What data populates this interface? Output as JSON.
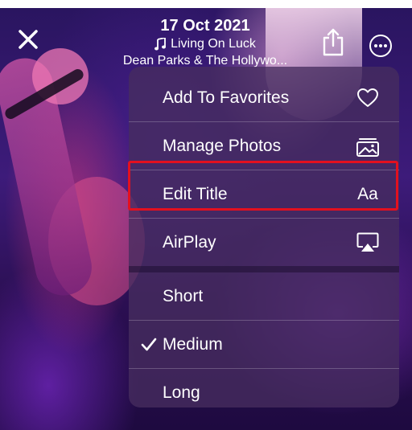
{
  "header": {
    "close_icon": "close-icon",
    "date": "17 Oct 2021",
    "music_icon": "music-note-icon",
    "song": "Living On Luck",
    "artist": "Dean Parks & The Hollywo...",
    "share_icon": "share-icon",
    "more_icon": "ellipsis-circle-icon"
  },
  "menu": {
    "items": [
      {
        "label": "Add To Favorites",
        "icon": "heart-icon"
      },
      {
        "label": "Manage Photos",
        "icon": "photos-icon"
      },
      {
        "label": "Edit Title",
        "icon": "text-format-icon",
        "icon_text": "Aa",
        "highlighted": true
      },
      {
        "label": "AirPlay",
        "icon": "airplay-icon"
      }
    ],
    "durations": [
      {
        "label": "Short",
        "selected": false
      },
      {
        "label": "Medium",
        "selected": true
      },
      {
        "label": "Long",
        "selected": false
      }
    ]
  },
  "colors": {
    "highlight": "#e3101f",
    "text": "#ffffff"
  }
}
